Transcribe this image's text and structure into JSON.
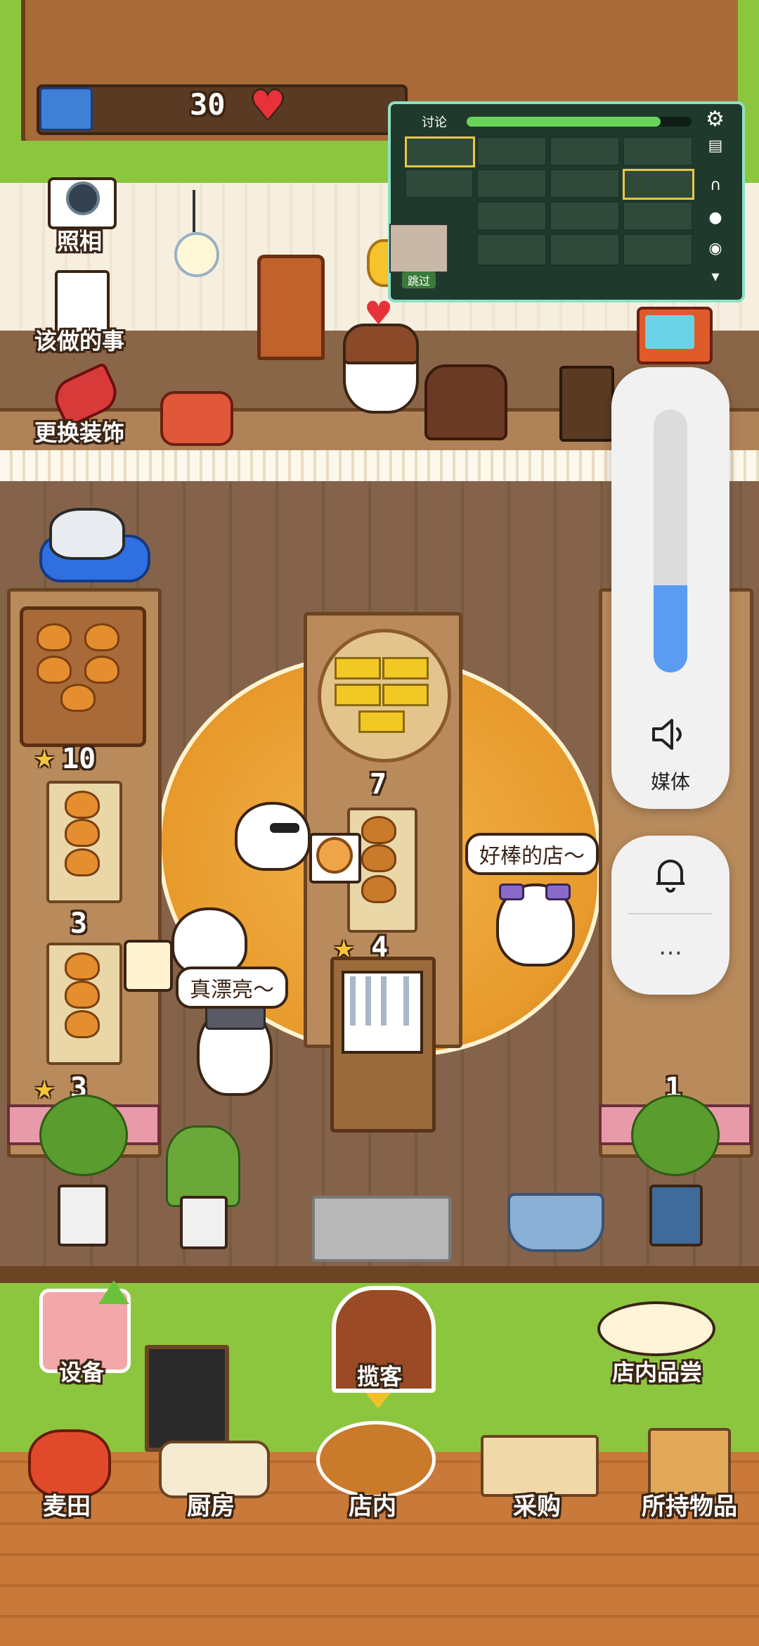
{
  "hud": {
    "tickets": "30",
    "heart_icon": "heart-icon"
  },
  "left_menu": {
    "camera_label": "照相",
    "todo_label": "该做的事",
    "decor_label": "更换装饰"
  },
  "shelves": {
    "left_top_level": "10",
    "left_mid_level": "3",
    "left_bottom_level": "3",
    "center_top_level": "7",
    "center_mid_level": "4",
    "right_bottom_level": "1"
  },
  "speech": {
    "bubble_left": "真漂亮～",
    "bubble_right": "好棒的店～"
  },
  "overlay": {
    "title": "讨论",
    "skip_label": "跳过"
  },
  "volume": {
    "media_label": "媒体",
    "level": 0.28,
    "more_label": "…"
  },
  "bottom_top_row": {
    "equipment": "设备",
    "attract": "揽客",
    "tasting": "店内品尝"
  },
  "bottom_nav": {
    "wheat": "麦田",
    "kitchen": "厨房",
    "shop": "店内",
    "purchase": "采购",
    "inventory": "所持物品"
  },
  "colors": {
    "grass": "#8cc63f",
    "wood_floor": "#7a5a3f",
    "wall": "#f6efe0",
    "accent_blue": "#5b9cf2"
  }
}
